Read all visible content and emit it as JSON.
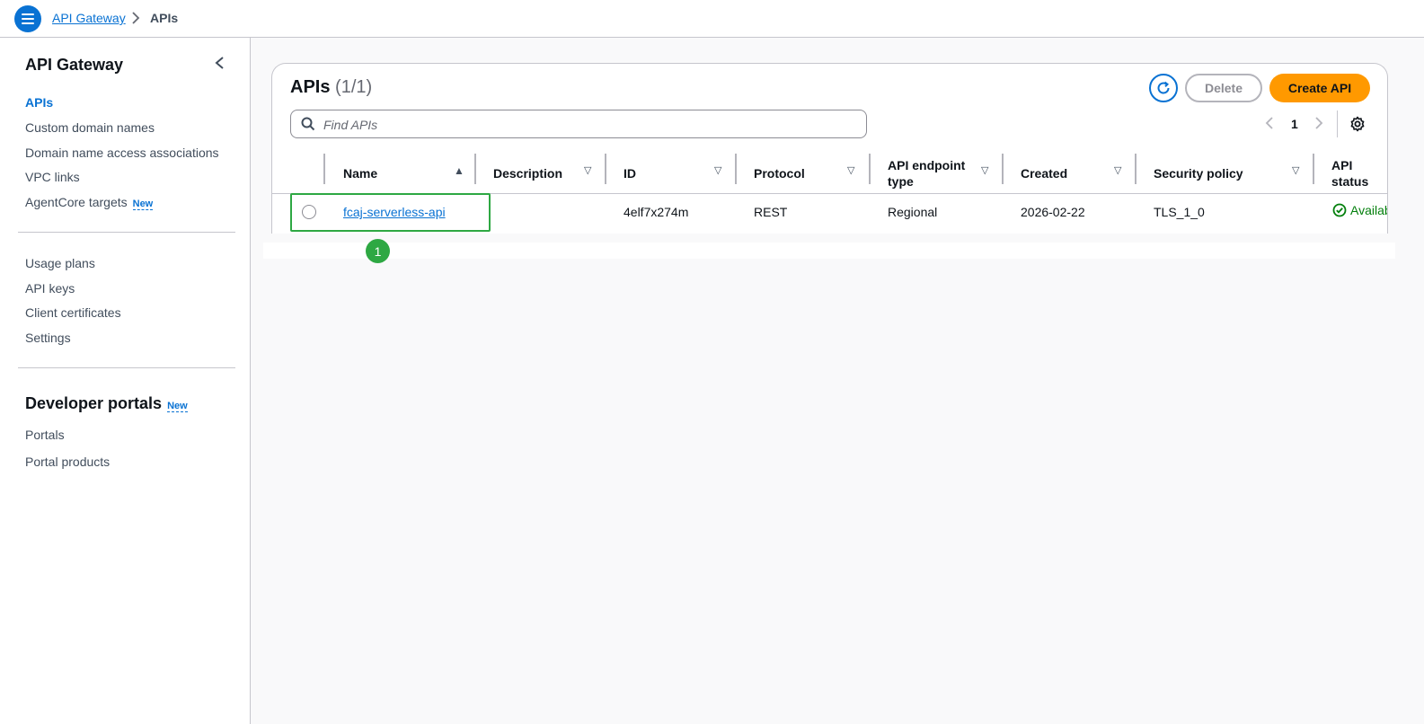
{
  "breadcrumb": {
    "root": "API Gateway",
    "current": "APIs"
  },
  "sidebar": {
    "title": "API Gateway",
    "items_primary": [
      {
        "label": "APIs",
        "active": true
      },
      {
        "label": "Custom domain names"
      },
      {
        "label": "Domain name access associations"
      },
      {
        "label": "VPC links"
      },
      {
        "label": "AgentCore targets",
        "badge": "New"
      }
    ],
    "items_secondary": [
      {
        "label": "Usage plans"
      },
      {
        "label": "API keys"
      },
      {
        "label": "Client certificates"
      },
      {
        "label": "Settings"
      }
    ],
    "developer_portals": {
      "heading": "Developer portals",
      "badge": "New",
      "items": [
        {
          "label": "Portals"
        },
        {
          "label": "Portal products"
        }
      ]
    }
  },
  "panel": {
    "title": "APIs",
    "count": "(1/1)",
    "delete_label": "Delete",
    "create_label": "Create API",
    "search_placeholder": "Find APIs",
    "page_number": "1"
  },
  "table": {
    "columns": [
      {
        "label": "Name"
      },
      {
        "label": "Description"
      },
      {
        "label": "ID"
      },
      {
        "label": "Protocol"
      },
      {
        "label": "API endpoint type"
      },
      {
        "label": "Created"
      },
      {
        "label": "Security policy"
      },
      {
        "label": "API status"
      }
    ],
    "rows": [
      {
        "name": "fcaj-serverless-api",
        "description": "",
        "id": "4elf7x274m",
        "protocol": "REST",
        "endpoint_type": "Regional",
        "created": "2026-02-22",
        "security_policy": "TLS_1_0",
        "status": "Available"
      }
    ]
  },
  "annotation": {
    "step": "1"
  },
  "colors": {
    "link": "#0972d3",
    "primary_button": "#ff9900",
    "highlight": "#2ea843",
    "status_ok": "#037f0c"
  }
}
